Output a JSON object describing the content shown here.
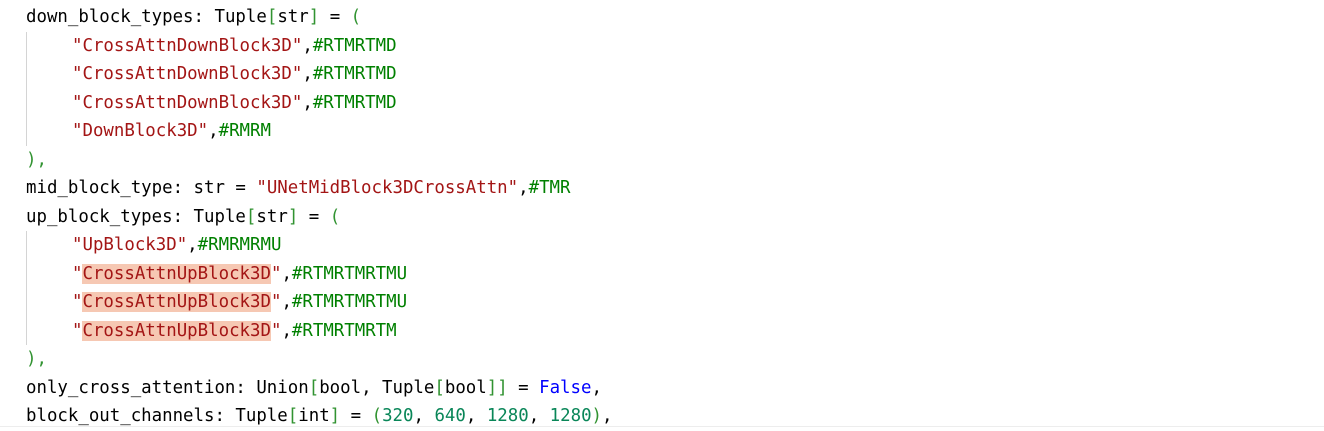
{
  "lines": [
    {
      "kind": "plain",
      "name": "down_block_types",
      "punct": ": ",
      "type_main": "Tuple",
      "type_arg": "str",
      "tail": " = ",
      "open": "("
    },
    {
      "kind": "item",
      "string": "\"CrossAttnDownBlock3D\"",
      "comma": ",",
      "comment": "#RTMRTMD"
    },
    {
      "kind": "item",
      "string": "\"CrossAttnDownBlock3D\"",
      "comma": ",",
      "comment": "#RTMRTMD"
    },
    {
      "kind": "item",
      "string": "\"CrossAttnDownBlock3D\"",
      "comma": ",",
      "comment": "#RTMRTMD"
    },
    {
      "kind": "item",
      "string": "\"DownBlock3D\"",
      "comma": ",",
      "comment": "#RMRM"
    },
    {
      "kind": "close",
      "text": "),"
    },
    {
      "kind": "mid",
      "name": "mid_block_type",
      "punct": ": str = ",
      "string": "\"UNetMidBlock3DCrossAttn\"",
      "comma": ",",
      "comment": "#TMR"
    },
    {
      "kind": "plain",
      "name": "up_block_types",
      "punct": ": ",
      "type_main": "Tuple",
      "type_arg": "str",
      "tail": " = ",
      "open": "("
    },
    {
      "kind": "item",
      "string": "\"UpBlock3D\"",
      "comma": ",",
      "comment": "#RMRMRMU"
    },
    {
      "kind": "hlitem",
      "q1": "\"",
      "string": "CrossAttnUpBlock3D",
      "q2": "\"",
      "comma": ",",
      "comment": "#RTMRTMRTMU"
    },
    {
      "kind": "hlitem",
      "q1": "\"",
      "string": "CrossAttnUpBlock3D",
      "q2": "\"",
      "comma": ",",
      "comment": "#RTMRTMRTMU"
    },
    {
      "kind": "hlitem",
      "q1": "\"",
      "string": "CrossAttnUpBlock3D",
      "q2": "\"",
      "comma": ",",
      "comment": "#RTMRTMRTM"
    },
    {
      "kind": "close",
      "text": "),"
    },
    {
      "kind": "union",
      "text1": "only_cross_attention: Union",
      "b1": "[",
      "t2": "bool, Tuple",
      "b2": "[",
      "t3": "bool",
      "b3": "]]",
      "t4": " = ",
      "kw": "False",
      "t5": ","
    },
    {
      "kind": "channels",
      "text1": "block_out_channels: Tuple",
      "b1": "[",
      "t2": "int",
      "b2": "]",
      "t3": " = ",
      "b3": "(",
      "n1": "320",
      "s1": ", ",
      "n2": "640",
      "s2": ", ",
      "n3": "1280",
      "s3": ", ",
      "n4": "1280",
      "b4": ")",
      "t4": ","
    }
  ],
  "colors": {
    "string": "#a31515",
    "comment": "#008000",
    "number": "#098658",
    "keyword": "#0000ff",
    "bracket": "#319331",
    "highlight": "#f6c8b3",
    "indent_guide": "#d4d4d4"
  }
}
